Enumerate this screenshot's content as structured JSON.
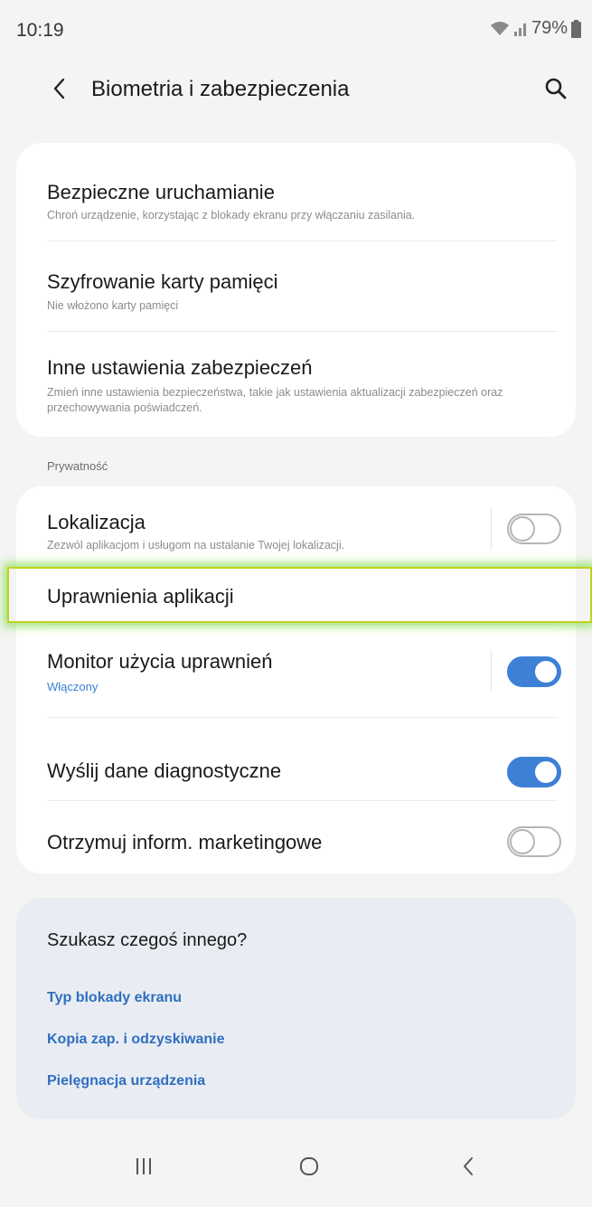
{
  "status_bar": {
    "time": "10:19",
    "battery": "79%"
  },
  "header": {
    "title": "Biometria i zabezpieczenia"
  },
  "security_items": [
    {
      "title": "Bezpieczne uruchamianie",
      "subtitle": "Chroń urządzenie, korzystając z blokady ekranu przy włączaniu zasilania."
    },
    {
      "title": "Szyfrowanie karty pamięci",
      "subtitle": "Nie włożono karty pamięci"
    },
    {
      "title": "Inne ustawienia zabezpieczeń",
      "subtitle": "Zmień inne ustawienia bezpieczeństwa, takie jak ustawienia aktualizacji zabezpieczeń oraz przechowywania poświadczeń."
    }
  ],
  "privacy": {
    "section_label": "Prywatność",
    "items": [
      {
        "title": "Lokalizacja",
        "subtitle": "Zezwól aplikacjom i usługom na ustalanie Twojej lokalizacji.",
        "toggle": false
      },
      {
        "title": "Uprawnienia aplikacji"
      },
      {
        "title": "Monitor użycia uprawnień",
        "subtitle": "Włączony",
        "toggle": true
      },
      {
        "title": "Wyślij dane diagnostyczne",
        "toggle": true
      },
      {
        "title": "Otrzymuj inform. marketingowe",
        "toggle": false
      }
    ]
  },
  "suggestions": {
    "title": "Szukasz czegoś innego?",
    "links": [
      "Typ blokady ekranu",
      "Kopia zap. i odzyskiwanie",
      "Pielęgnacja urządzenia"
    ]
  },
  "colors": {
    "accent": "#3e80d6",
    "link": "#2f6fbf",
    "highlight_border": "#c1d21e",
    "suggest_bg": "#e9edf3"
  }
}
